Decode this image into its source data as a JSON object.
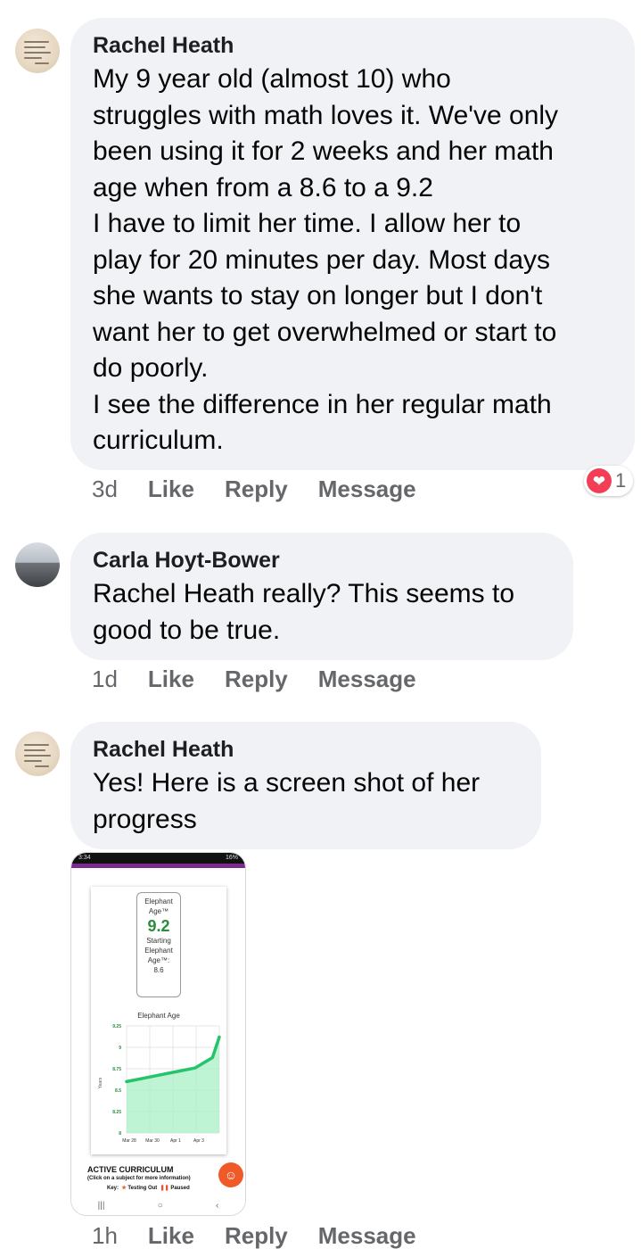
{
  "comments": [
    {
      "author": "Rachel Heath",
      "text": "My 9 year old (almost 10) who\nstruggles with math loves it. We've only\nbeen using it for 2 weeks and her math\nage when from a 8.6 to a 9.2\nI have to limit her time. I allow her to\nplay for 20 minutes per day. Most days\nshe wants to stay on longer but I don't\nwant her to get overwhelmed or start to\ndo poorly.\nI see the difference in her regular math\ncurriculum.",
      "time": "3d",
      "like": "Like",
      "reply": "Reply",
      "message": "Message",
      "reaction_count": "1",
      "reaction_icon": "heart-icon",
      "reaction_color": "#f33e58"
    },
    {
      "author": "Carla Hoyt-Bower",
      "text": "Rachel Heath really? This seems to\ngood to be true.",
      "time": "1d",
      "like": "Like",
      "reply": "Reply",
      "message": "Message"
    },
    {
      "author": "Rachel Heath",
      "text": "Yes! Here is a screen shot of her\nprogress",
      "time": "1h",
      "like": "Like",
      "reply": "Reply",
      "message": "Message"
    }
  ],
  "screenshot": {
    "status_time": "3:34",
    "status_battery": "16%",
    "age_label": "Elephant Age™",
    "age_value": "9.2",
    "starting_label": "Starting Elephant Age™:",
    "starting_value": "8.6",
    "active_title": "ACTIVE CURRICULUM",
    "active_sub": "(Click on a subject for more information)",
    "key_label": "Key:",
    "key_testing": "Testing Out",
    "key_paused": "Paused",
    "accent_color": "#7b2a8e"
  },
  "chart_data": {
    "type": "area",
    "title": "Elephant Age",
    "xlabel": "",
    "ylabel": "Years",
    "ylim": [
      8,
      9.25
    ],
    "yticks": [
      "9.25",
      "9",
      "8.75",
      "8.5",
      "8.25",
      "8"
    ],
    "xticks": [
      "Mar 28",
      "Mar 30",
      "Apr 1",
      "Apr 3"
    ],
    "series": [
      {
        "x": [
          0,
          1,
          2,
          3,
          4,
          5,
          5.4
        ],
        "values": [
          8.6,
          8.64,
          8.68,
          8.72,
          8.76,
          8.88,
          9.12
        ]
      }
    ],
    "line_color": "#27c36b",
    "fill_color": "#aef0c9"
  }
}
